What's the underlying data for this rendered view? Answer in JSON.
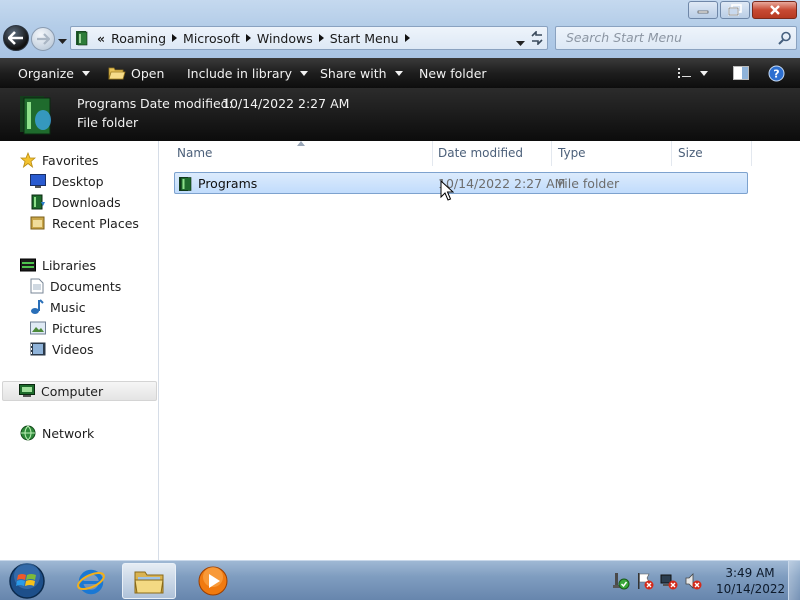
{
  "window": {
    "minimize_icon": "minimize-icon",
    "maximize_icon": "restore-icon",
    "close_icon": "close-icon"
  },
  "address": {
    "breadcrumb": [
      "Roaming",
      "Microsoft",
      "Windows",
      "Start Menu"
    ],
    "overflow_glyph": "«"
  },
  "search": {
    "placeholder": "Search Start Menu"
  },
  "toolbar": {
    "organize": "Organize",
    "open": "Open",
    "include_in_library": "Include in library",
    "share_with": "Share with",
    "new_folder": "New folder"
  },
  "details_pane": {
    "name": "Programs",
    "date_label": "Date modified:",
    "date_value": "10/14/2022 2:27 AM",
    "type": "File folder"
  },
  "navigation": {
    "favorites": "Favorites",
    "desktop": "Desktop",
    "downloads": "Downloads",
    "recent_places": "Recent Places",
    "libraries": "Libraries",
    "documents": "Documents",
    "music": "Music",
    "pictures": "Pictures",
    "videos": "Videos",
    "computer": "Computer",
    "network": "Network"
  },
  "columns": {
    "name": "Name",
    "date_modified": "Date modified",
    "type": "Type",
    "size": "Size"
  },
  "files": [
    {
      "name": "Programs",
      "date_modified": "10/14/2022 2:27 AM",
      "type": "File folder",
      "size": ""
    }
  ],
  "taskbar": {
    "time": "3:49 AM",
    "date": "10/14/2022"
  },
  "colors": {
    "selection_bg": "#c1dcfc",
    "selection_border": "#7da2ce",
    "toolbar_dark": "#1e1e1e",
    "column_header_text": "#4c607a"
  }
}
